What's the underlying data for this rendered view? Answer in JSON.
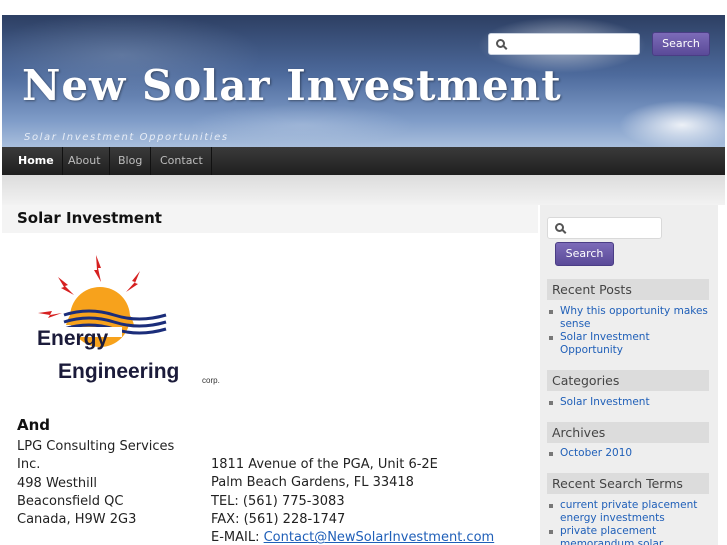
{
  "site": {
    "title": "New Solar Investment",
    "tagline": "Solar Investment Opportunities"
  },
  "header_search": {
    "placeholder": "",
    "button_label": "Search"
  },
  "nav": {
    "items": [
      {
        "label": "Home",
        "active": true
      },
      {
        "label": "About",
        "active": false
      },
      {
        "label": "Blog",
        "active": false
      },
      {
        "label": "Contact",
        "active": false
      }
    ]
  },
  "post": {
    "title": "Solar Investment",
    "logo": {
      "line1": "Energy",
      "line2": "Engineering",
      "suffix": "corp."
    },
    "and_label": "And",
    "address_left": [
      "LPG Consulting Services",
      "Inc.",
      "498 Westhill",
      "Beaconsfield QC",
      "Canada, H9W 2G3"
    ],
    "address_right": [
      "1811 Avenue of the PGA, Unit 6-2E",
      "Palm Beach Gardens, FL 33418",
      "TEL: (561) 775-3083",
      "FAX: (561) 228-1747"
    ],
    "email_label": "E-MAIL: ",
    "email": "Contact@NewSolarInvestment.com"
  },
  "sidebar": {
    "search": {
      "placeholder": "",
      "button_label": "Search"
    },
    "recent_posts": {
      "title": "Recent Posts",
      "items": [
        "Why this opportunity makes sense",
        "Solar Investment Opportunity"
      ]
    },
    "categories": {
      "title": "Categories",
      "items": [
        "Solar Investment"
      ]
    },
    "archives": {
      "title": "Archives",
      "items": [
        "October 2010"
      ]
    },
    "recent_search": {
      "title": "Recent Search Terms",
      "items": [
        "current private placement energy investments",
        "private placement memorandum solar"
      ]
    }
  },
  "colors": {
    "accent_button": "#5a4a98",
    "link": "#1f5fb8",
    "nav_bg": "#2a2a2a"
  }
}
